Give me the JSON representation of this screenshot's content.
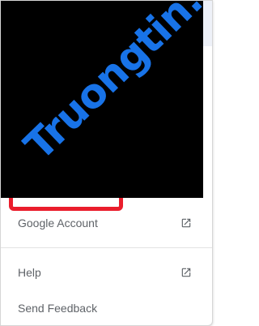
{
  "watermark": {
    "text": "Truongtin.top"
  },
  "menu": {
    "google_account_label": "Google Account",
    "help_label": "Help",
    "send_feedback_label": "Send Feedback"
  },
  "icons": {
    "external_link": "external-link-icon"
  },
  "colors": {
    "highlight": "#ea1d2c",
    "watermark": "#1873e8",
    "label_text": "#5f6368"
  }
}
